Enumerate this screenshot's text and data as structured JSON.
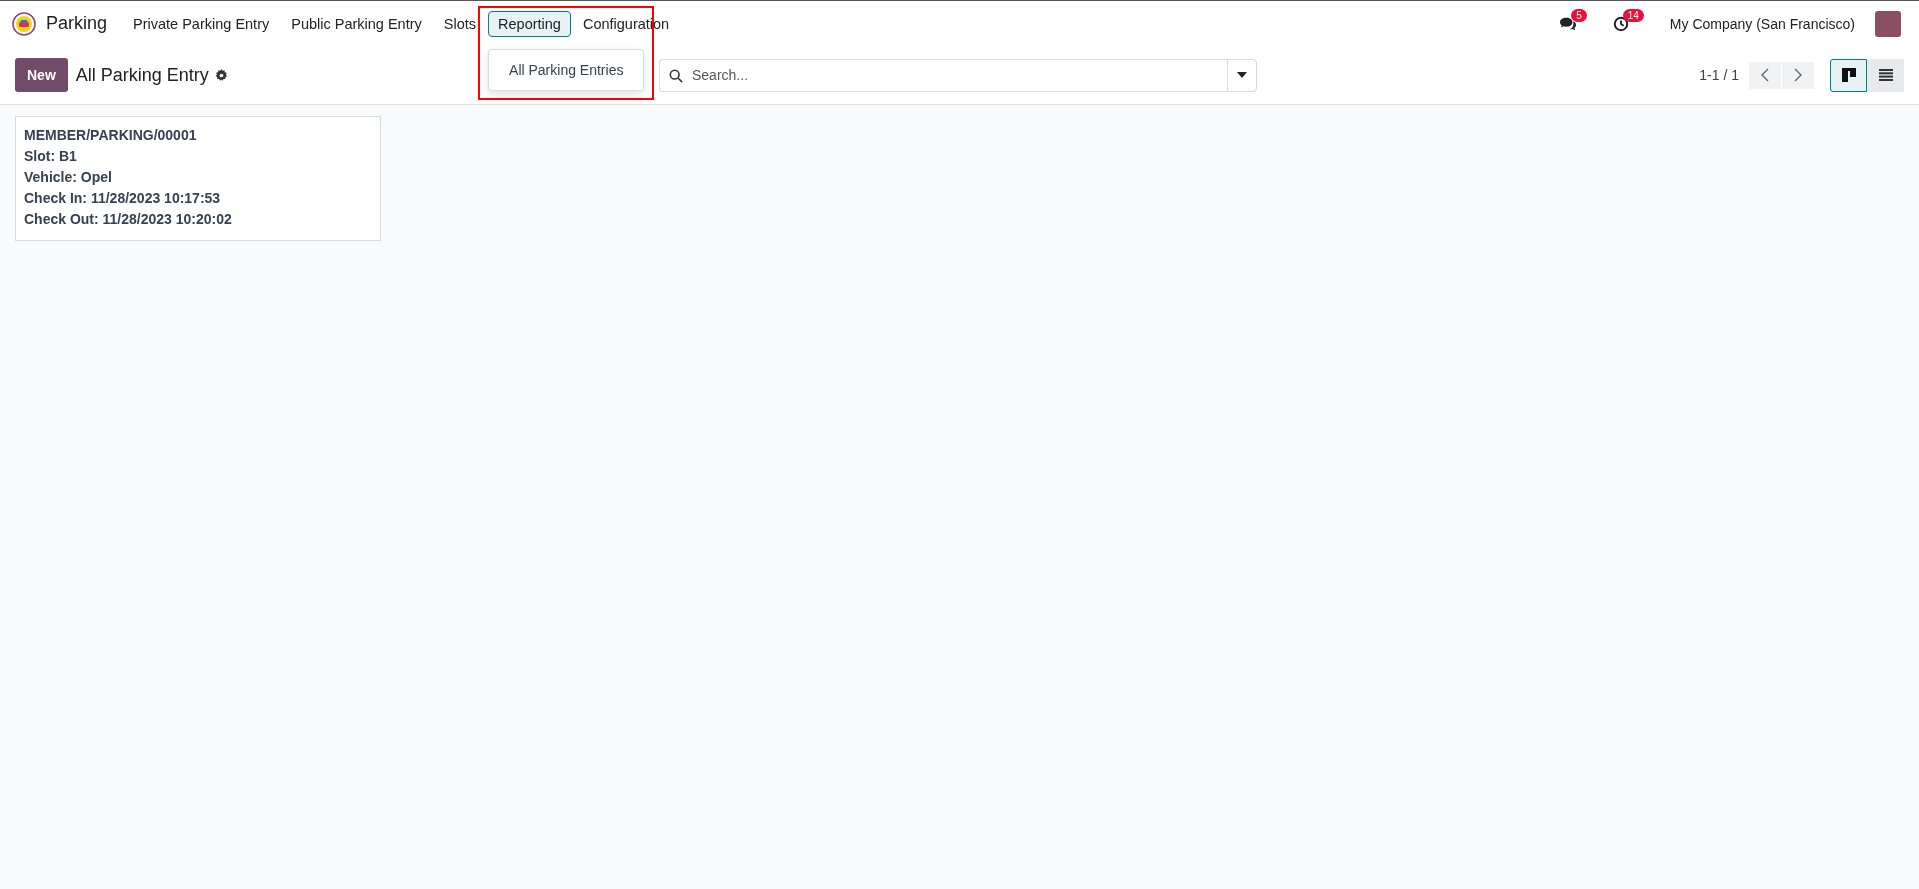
{
  "app": {
    "name": "Parking"
  },
  "menu": [
    {
      "label": "Private Parking Entry",
      "selected": false
    },
    {
      "label": "Public Parking Entry",
      "selected": false
    },
    {
      "label": "Slots",
      "selected": false
    },
    {
      "label": "Reporting",
      "selected": true,
      "dropdown": [
        "All Parking Entries"
      ]
    },
    {
      "label": "Configuration",
      "selected": false
    }
  ],
  "systray": {
    "messages_badge": "5",
    "activities_badge": "14",
    "company": "My Company (San Francisco)"
  },
  "control_panel": {
    "new_button": "New",
    "title": "All Parking Entry",
    "search": {
      "placeholder": "Search..."
    },
    "pager": "1-1 / 1",
    "views": [
      {
        "kind": "kanban",
        "selected": true
      },
      {
        "kind": "list",
        "selected": false
      }
    ]
  },
  "cards": [
    {
      "lines": [
        "MEMBER/PARKING/00001",
        "Slot: B1",
        "Vehicle: Opel",
        "Check In: 11/28/2023 10:17:53",
        "Check Out: 11/28/2023 10:20:02"
      ]
    }
  ]
}
